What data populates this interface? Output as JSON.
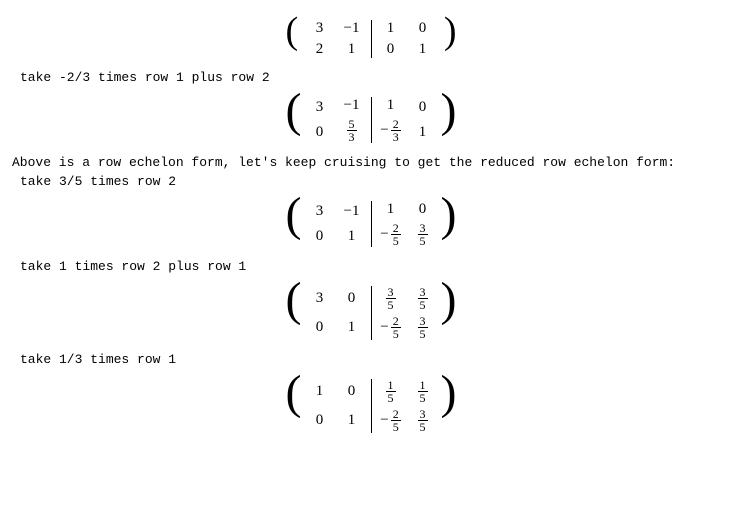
{
  "steps": {
    "s1": "take -2/3 times row 1 plus row 2",
    "s2": "Above is a row echelon form, let's keep cruising to get the reduced row echelon form:",
    "s3": "take 3/5 times row 2",
    "s4": "take 1 times row 2 plus row 1",
    "s5": "take 1/3 times row 1"
  },
  "m1": {
    "left": [
      [
        "3",
        "-1"
      ],
      [
        "2",
        "1"
      ]
    ],
    "right": [
      [
        "1",
        "0"
      ],
      [
        "0",
        "1"
      ]
    ]
  },
  "m2": {
    "left": [
      [
        "3",
        "-1"
      ],
      [
        "0",
        {
          "frac": [
            "5",
            "3"
          ]
        }
      ]
    ],
    "right": [
      [
        "1",
        "0"
      ],
      [
        {
          "neg": true,
          "frac": [
            "2",
            "3"
          ]
        },
        "1"
      ]
    ]
  },
  "m3": {
    "left": [
      [
        "3",
        "-1"
      ],
      [
        "0",
        "1"
      ]
    ],
    "right": [
      [
        "1",
        "0"
      ],
      [
        {
          "neg": true,
          "frac": [
            "2",
            "5"
          ]
        },
        {
          "frac": [
            "3",
            "5"
          ]
        }
      ]
    ]
  },
  "m4": {
    "left": [
      [
        "3",
        "0"
      ],
      [
        "0",
        "1"
      ]
    ],
    "right": [
      [
        {
          "frac": [
            "3",
            "5"
          ]
        },
        {
          "frac": [
            "3",
            "5"
          ]
        }
      ],
      [
        {
          "neg": true,
          "frac": [
            "2",
            "5"
          ]
        },
        {
          "frac": [
            "3",
            "5"
          ]
        }
      ]
    ]
  },
  "m5": {
    "left": [
      [
        "1",
        "0"
      ],
      [
        "0",
        "1"
      ]
    ],
    "right": [
      [
        {
          "frac": [
            "1",
            "5"
          ]
        },
        {
          "frac": [
            "1",
            "5"
          ]
        }
      ],
      [
        {
          "neg": true,
          "frac": [
            "2",
            "5"
          ]
        },
        {
          "frac": [
            "3",
            "5"
          ]
        }
      ]
    ]
  },
  "chart_data": {
    "type": "table",
    "title": "Gauss-Jordan elimination to find inverse of 2x2 matrix",
    "initial_matrix": [
      [
        3,
        -1
      ],
      [
        2,
        1
      ]
    ],
    "initial_identity": [
      [
        1,
        0
      ],
      [
        0,
        1
      ]
    ],
    "row_operations": [
      {
        "op": "R2 := (-2/3)R1 + R2",
        "result_left": [
          [
            3,
            -1
          ],
          [
            0,
            "5/3"
          ]
        ],
        "result_right": [
          [
            1,
            0
          ],
          [
            "-2/3",
            1
          ]
        ]
      },
      {
        "op": "R2 := (3/5)R2",
        "result_left": [
          [
            3,
            -1
          ],
          [
            0,
            1
          ]
        ],
        "result_right": [
          [
            1,
            0
          ],
          [
            "-2/5",
            "3/5"
          ]
        ]
      },
      {
        "op": "R1 := 1*R2 + R1",
        "result_left": [
          [
            3,
            0
          ],
          [
            0,
            1
          ]
        ],
        "result_right": [
          [
            "3/5",
            "3/5"
          ],
          [
            "-2/5",
            "3/5"
          ]
        ]
      },
      {
        "op": "R1 := (1/3)R1",
        "result_left": [
          [
            1,
            0
          ],
          [
            0,
            1
          ]
        ],
        "result_right": [
          [
            "1/5",
            "1/5"
          ],
          [
            "-2/5",
            "3/5"
          ]
        ]
      }
    ],
    "inverse_matrix": [
      [
        "1/5",
        "1/5"
      ],
      [
        "-2/5",
        "3/5"
      ]
    ]
  }
}
